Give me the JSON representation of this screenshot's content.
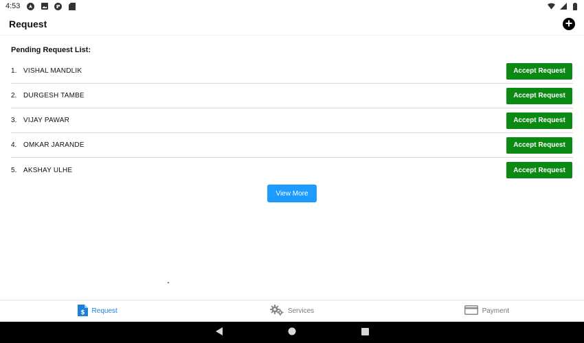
{
  "status_bar": {
    "time": "4:53",
    "left_icons": [
      "navigation-icon",
      "photo-icon",
      "media-icon",
      "sim-icon"
    ],
    "right_icons": [
      "wifi-icon",
      "signal-icon",
      "battery-icon"
    ]
  },
  "header": {
    "title": "Request",
    "add_icon": "plus-circle-icon"
  },
  "pending": {
    "title": "Pending Request List:",
    "items": [
      {
        "index": "1.",
        "name": "VISHAL MANDLIK",
        "action": "Accept Request"
      },
      {
        "index": "2.",
        "name": "DURGESH TAMBE",
        "action": "Accept Request"
      },
      {
        "index": "3.",
        "name": "VIJAY PAWAR",
        "action": "Accept Request"
      },
      {
        "index": "4.",
        "name": "OMKAR JARANDE",
        "action": "Accept Request"
      },
      {
        "index": "5.",
        "name": "AKSHAY ULHE",
        "action": "Accept Request"
      }
    ],
    "view_more": "View More"
  },
  "tabs": [
    {
      "label": "Request",
      "icon": "request-doc-icon",
      "active": true
    },
    {
      "label": "Services",
      "icon": "gears-icon",
      "active": false
    },
    {
      "label": "Payment",
      "icon": "card-icon",
      "active": false
    }
  ],
  "colors": {
    "accept": "#0a8a13",
    "view_more": "#1e9bff",
    "tab_active": "#1e7fd6",
    "tab_inactive": "#777777",
    "nav_bar": "#000000"
  }
}
